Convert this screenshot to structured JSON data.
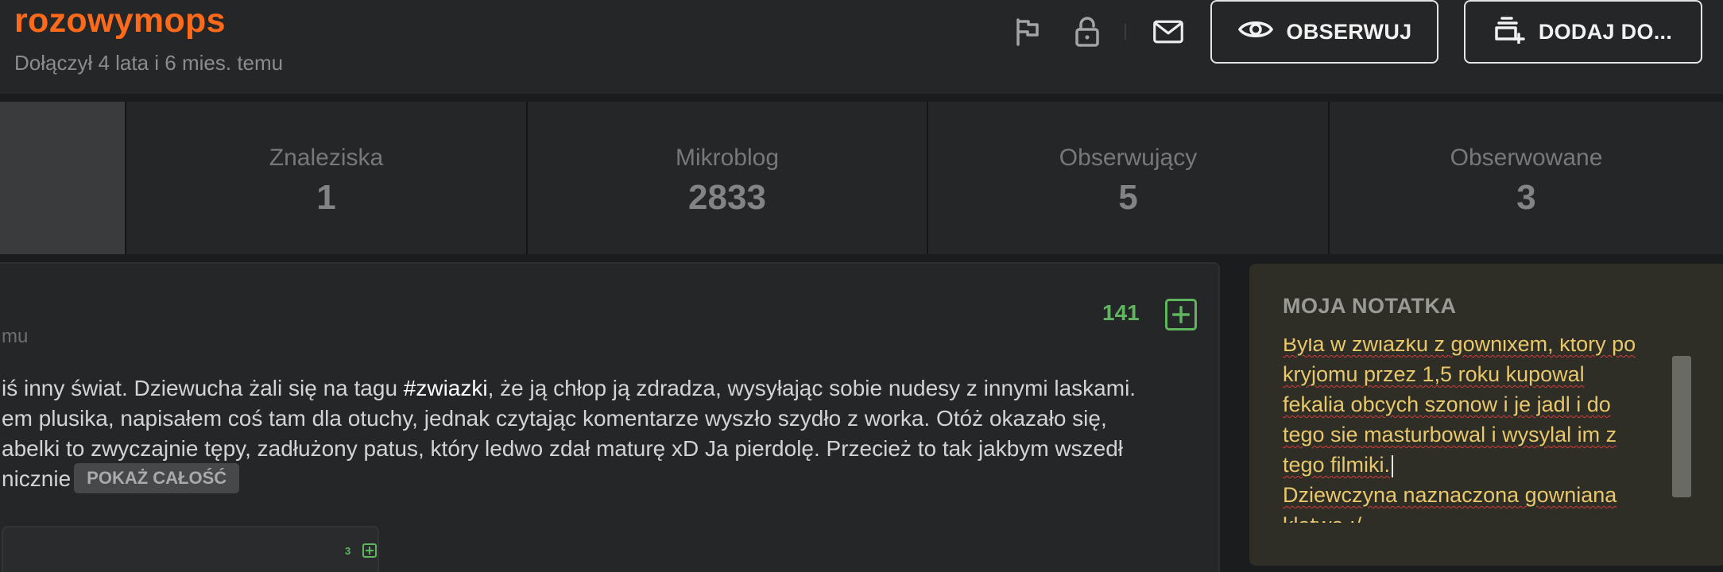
{
  "profile": {
    "username": "rozowymops",
    "joined": "Dołączył 4 lata i 6 mies. temu"
  },
  "header_actions": {
    "icons": [
      "flag-icon",
      "lock-icon",
      "mail-icon"
    ],
    "follow_button": {
      "label": "OBSERWUJ",
      "icon": "eye-icon"
    },
    "add_button": {
      "label": "DODAJ DO...",
      "icon": "add-to-list-icon"
    }
  },
  "stats": [
    {
      "label": "Znaleziska",
      "value": "1"
    },
    {
      "label": "Mikroblog",
      "value": "2833"
    },
    {
      "label": "Obserwujący",
      "value": "5"
    },
    {
      "label": "Obserwowane",
      "value": "3"
    }
  ],
  "post": {
    "meta": "mu",
    "votes": "141",
    "line1_start": "iś inny świat. Dziewucha żali się na tagu ",
    "tag": "#zwiazki",
    "line1_end": ", że ją chłop ją zdradza, wysyłając sobie nudesy z innymi laskami.",
    "line2": "em plusika, napisałem coś tam dla otuchy, jednak czytając komentarze wyszło szydło z worka. Otóż okazało się,",
    "line3": "abelki to zwyczajnie tępy, zadłużony patus, który ledwo zdał maturę xD Ja pierdolę. Przecież to tak jakbym wszedł",
    "line4": "nicznie",
    "show_all": "POKAŻ CAŁOŚĆ",
    "comment_votes": "3"
  },
  "note": {
    "title": "MOJA NOTATKA",
    "lines": [
      "Byla w zwiazku z gownixem, ktory po",
      "kryjomu przez 1,5 roku kupowal",
      "fekalia obcych szonow i je jadl i do",
      "tego sie masturbowal i wysylal im z",
      "tego filmiki.",
      "Dziewczyna naznaczona gowniana",
      "klatwa :/"
    ]
  },
  "colors": {
    "accent_orange": "#ff6a1a",
    "vote_green": "#5fb65f",
    "note_text": "#e8c86a",
    "spellcheck_red": "#d23b3b"
  }
}
